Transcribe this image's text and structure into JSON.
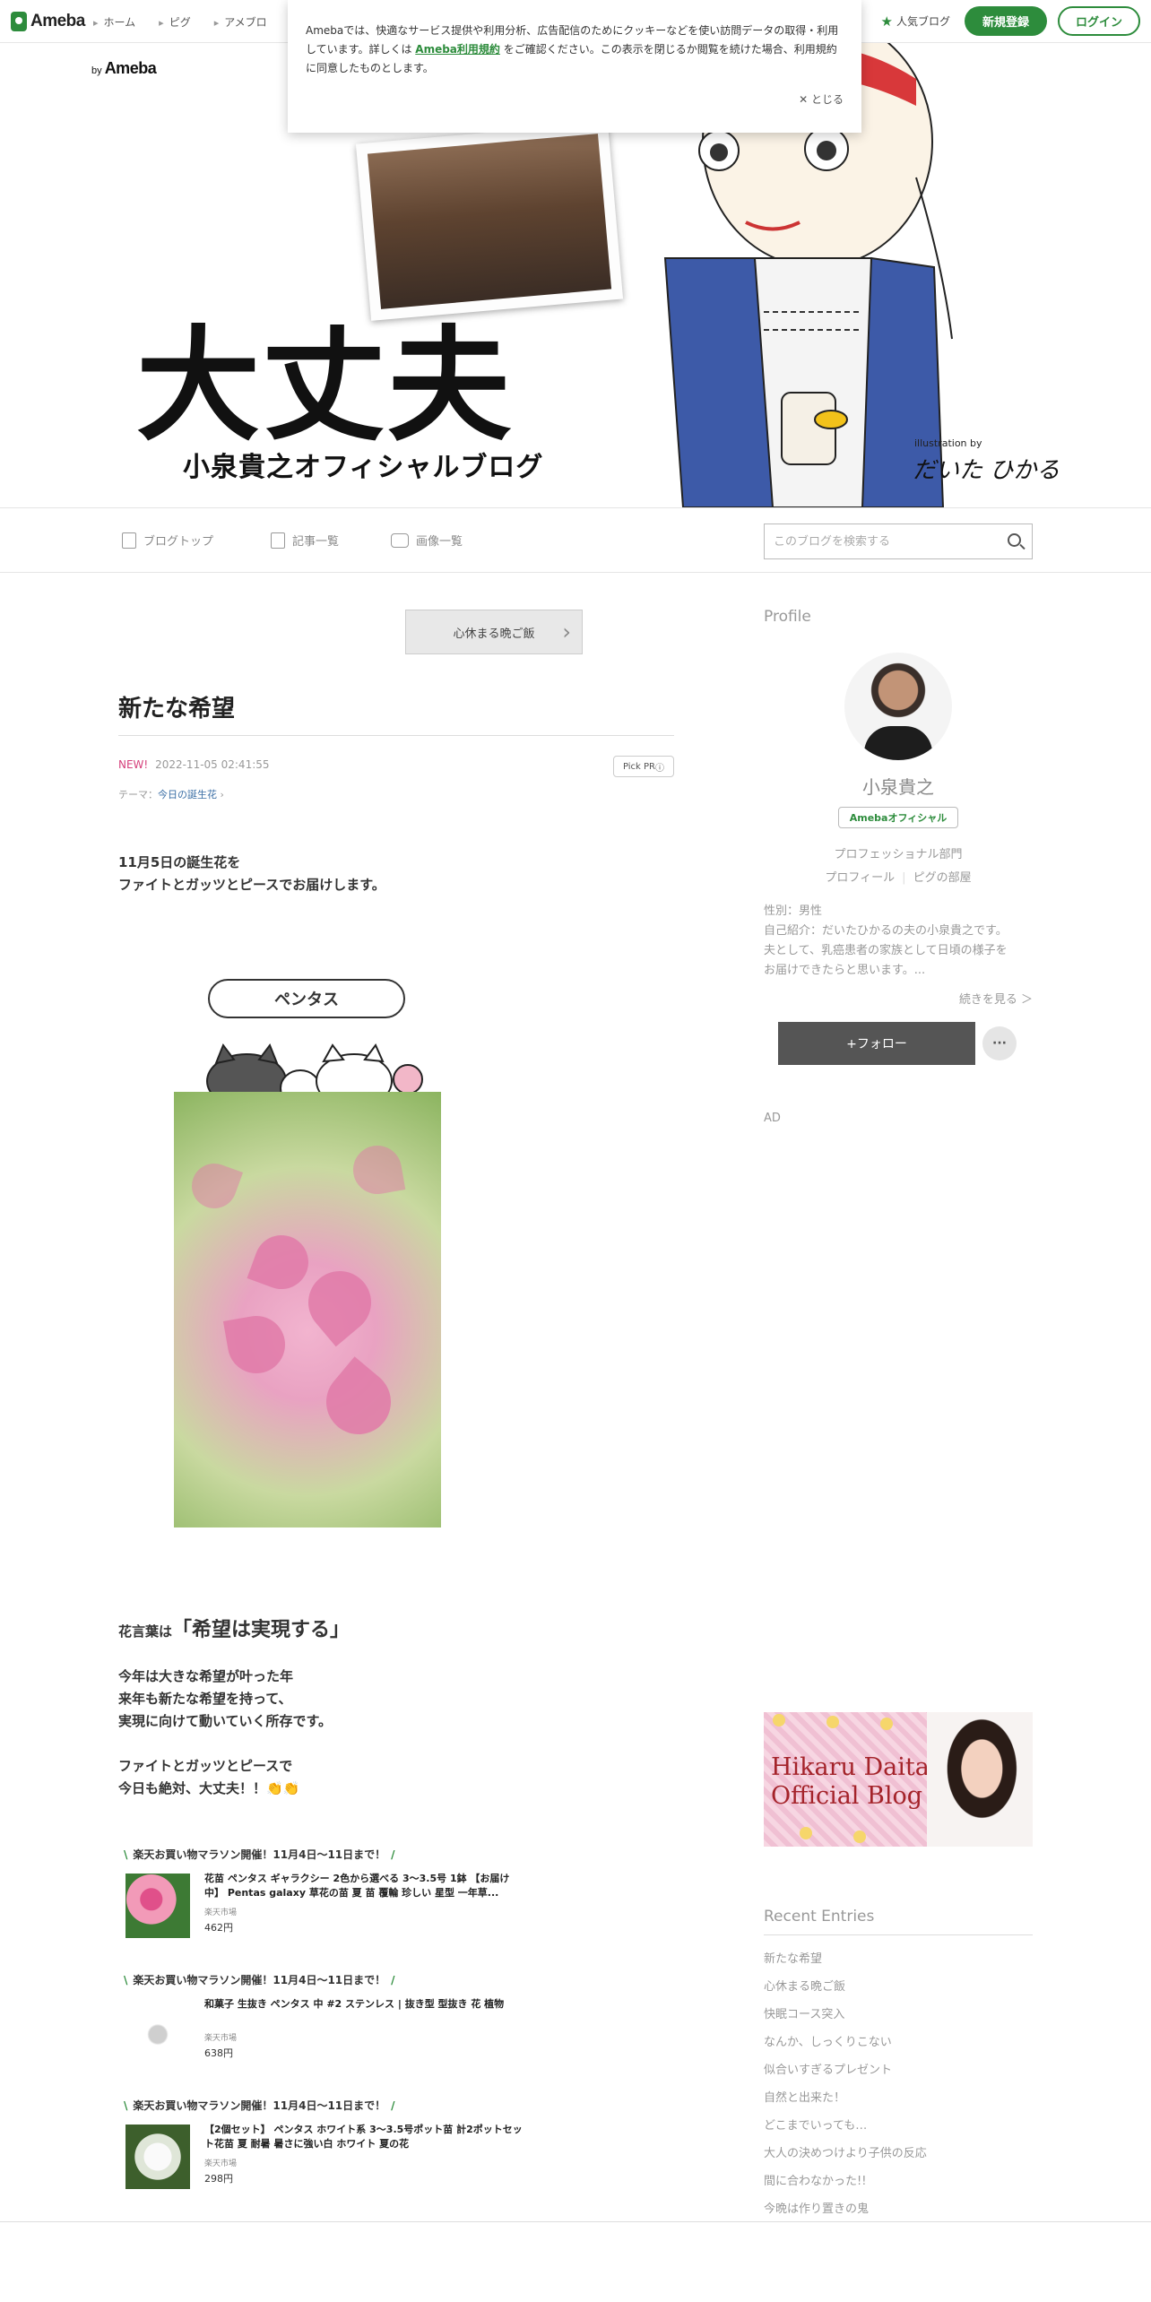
{
  "nav": {
    "logo": "Ameba",
    "links": [
      "ホーム",
      "ピグ",
      "アメブロ"
    ],
    "ranking": "人気ブログ",
    "register": "新規登録",
    "login": "ログイン"
  },
  "cookie": {
    "text_before": "Amebaでは、快適なサービス提供や利用分析、広告配信のためにクッキーなどを使い訪問データの取得・利用しています。詳しくは",
    "link": "Ameba利用規約",
    "text_after": "をご確認ください。この表示を閉じるか閲覧を続けた場合、利用規約に同意したものとします。",
    "close": "とじる"
  },
  "header": {
    "by_label": "by",
    "by_brand": "Ameba",
    "title": "大丈夫",
    "subtitle": "小泉貴之オフィシャルブログ",
    "illustration_by": "illustration by",
    "illustrator": "だいた ひかる"
  },
  "blognav": {
    "items": [
      "ブログトップ",
      "記事一覧",
      "画像一覧"
    ],
    "search_placeholder": "このブログを検索する"
  },
  "article": {
    "prev_label": "心休まる晩ご飯",
    "title": "新たな希望",
    "new_label": "NEW!",
    "date": "2022-11-05 02:41:55",
    "pickpr": "Pick PR",
    "theme_label": "テーマ：",
    "theme": "今日の誕生花",
    "intro": [
      "11月5日の誕生花を",
      "ファイトとガッツとピースでお届けします。"
    ],
    "bubble": "ペンタス",
    "hanakotoba_label": "花言葉は",
    "hanakotoba": "「希望は実現する」",
    "body": [
      "今年は大きな希望が叶った年",
      "来年も新たな希望を持って、",
      "実現に向けて動いていく所存です。"
    ],
    "body2": [
      "ファイトとガッツとピースで",
      "今日も絶対、大丈夫！！"
    ],
    "shop_items": [
      {
        "head": "楽天お買い物マラソン開催！11月4日～11日まで！",
        "name": "花苗 ペンタス ギャラクシー 2色から選べる 3～3.5号 1鉢 【お届け中】 Pentas galaxy 草花の苗 夏 苗 覆輪 珍しい 星型 一年草...",
        "source": "楽天市場",
        "price": "462円"
      },
      {
        "head": "楽天お買い物マラソン開催！11月4日～11日まで！",
        "name": "和菓子 生抜き ペンタス 中 #2 ステンレス | 抜き型 型抜き 花 植物",
        "source": "楽天市場",
        "price": "638円"
      },
      {
        "head": "楽天お買い物マラソン開催！11月4日～11日まで！",
        "name": "【2個セット】 ペンタス ホワイト系 3～3.5号ポット苗 計2ポットセット花苗 夏 耐暑 暑さに強い白 ホワイト 夏の花",
        "source": "楽天市場",
        "price": "298円"
      }
    ]
  },
  "sidebar": {
    "profile_title": "Profile",
    "name": "小泉貴之",
    "official": "Amebaオフィシャル",
    "category": "プロフェッショナル部門",
    "profile_link": "プロフィール",
    "pig_link": "ピグの部屋",
    "gender": "性別：男性",
    "intro": [
      "自己紹介：だいたひかるの夫の小泉貴之です。",
      "夫として、乳癌患者の家族として日頃の様子を",
      "お届けできたらと思います。..."
    ],
    "more": "続きを見る ＞",
    "follow": "+フォロー",
    "dots": "···",
    "ad": "AD",
    "banner_text": [
      "Hikaru Daita",
      "Official Blog"
    ],
    "recent_title": "Recent Entries",
    "recent": [
      "新たな希望",
      "心休まる晩ご飯",
      "快眠コース突入",
      "なんか、しっくりこない",
      "似合いすぎるプレゼント",
      "自然と出来た！",
      "どこまでいっても…",
      "大人の決めつけより子供の反応",
      "間に合わなかった!!",
      "今晩は作り置きの鬼"
    ]
  },
  "colors": {
    "brand": "#2d8c3c",
    "new": "#d5407b",
    "theme_link": "#3a6ea5",
    "heading": "#a4232a"
  }
}
